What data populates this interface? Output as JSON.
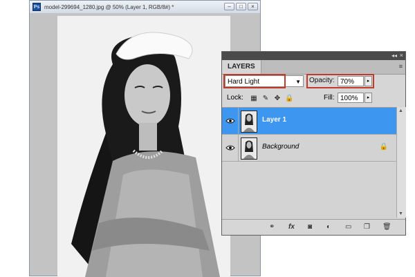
{
  "document": {
    "title": "model-299694_1280.jpg @ 50% (Layer 1, RGB/8#) *",
    "app_badge": "Ps",
    "window_buttons": [
      "–",
      "□",
      "×"
    ]
  },
  "layers_panel": {
    "tab_label": "LAYERS",
    "collapse_glyph": "◂◂",
    "close_glyph": "×",
    "menu_glyph": "≡",
    "blend_mode": "Hard Light",
    "opacity_label": "Opacity:",
    "opacity_value": "70%",
    "lock_label": "Lock:",
    "fill_label": "Fill:",
    "fill_value": "100%",
    "layers": [
      {
        "name": "Layer 1",
        "selected": true,
        "locked": false
      },
      {
        "name": "Background",
        "selected": false,
        "locked": true
      }
    ],
    "footer_icons": [
      "link-icon",
      "fx-icon",
      "mask-icon",
      "adjustment-icon",
      "group-icon",
      "new-layer-icon",
      "trash-icon"
    ],
    "footer_glyphs": {
      "link": "⚭",
      "fx": "fx",
      "mask": "◙",
      "adjust": "◐",
      "group": "▭",
      "newlayer": "❐",
      "trash": "🗑"
    }
  },
  "colors": {
    "selection": "#3d96f0",
    "highlight": "#c0392b"
  }
}
